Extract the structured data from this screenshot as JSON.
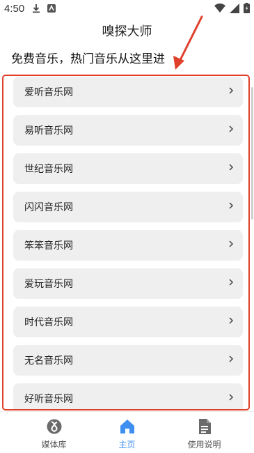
{
  "status_bar": {
    "time": "4:50",
    "left_icons": [
      "download-icon",
      "app-notification-icon"
    ],
    "right_icons": [
      "wifi-icon",
      "cellular-signal-icon",
      "battery-icon"
    ]
  },
  "header": {
    "title": "嗅探大师"
  },
  "subtitle": "免费音乐，热门音乐从这里进",
  "annotation": {
    "color": "#e0402a",
    "arrow": "red-arrow-pointing-to-list"
  },
  "site_list": {
    "items": [
      {
        "label": "爱听音乐网"
      },
      {
        "label": "易听音乐网"
      },
      {
        "label": "世纪音乐网"
      },
      {
        "label": "闪闪音乐网"
      },
      {
        "label": "笨笨音乐网"
      },
      {
        "label": "爱玩音乐网"
      },
      {
        "label": "时代音乐网"
      },
      {
        "label": "无名音乐网"
      },
      {
        "label": "好听音乐网"
      }
    ],
    "chevron_icon": "chevron-right-icon"
  },
  "bottom_nav": {
    "accent_color": "#3f8ff0",
    "items": [
      {
        "label": "媒体库",
        "icon": "media-library-icon",
        "active": false
      },
      {
        "label": "主页",
        "icon": "home-icon",
        "active": true
      },
      {
        "label": "使用说明",
        "icon": "document-icon",
        "active": false
      }
    ]
  }
}
